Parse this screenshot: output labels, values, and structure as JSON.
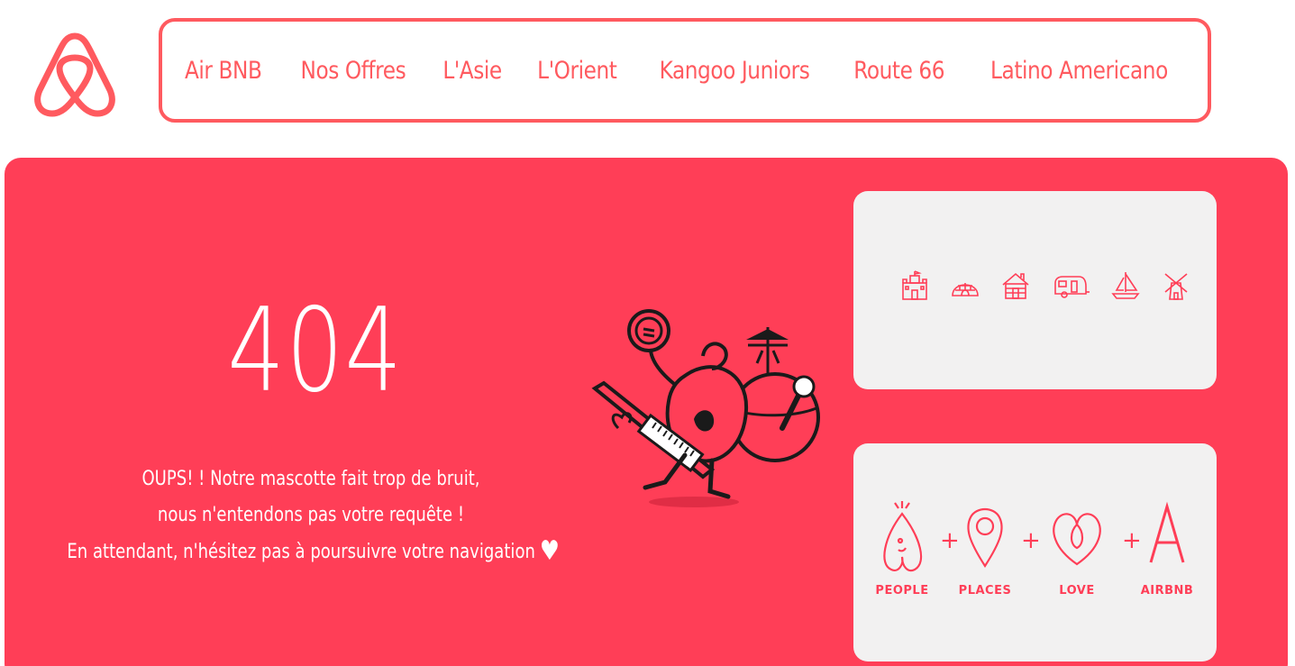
{
  "brand": {
    "logo_icon": "airbnb-belo-icon",
    "accent_color": "#ff5a5f",
    "panel_color": "#ff3e57"
  },
  "nav": {
    "items": [
      {
        "label": "Air BNB"
      },
      {
        "label": "Nos Offres"
      },
      {
        "label": "L'Asie"
      },
      {
        "label": "L'Orient"
      },
      {
        "label": "Kangoo Juniors"
      },
      {
        "label": "Route 66"
      },
      {
        "label": "Latino Americano"
      }
    ]
  },
  "error": {
    "code": "404",
    "message_line1": "OUPS! ! Notre mascotte fait trop de bruit,",
    "message_line2": "nous n'entendons pas votre requête !",
    "message_line3": "En attendant, n'hésitez pas à poursuivre votre navigation",
    "heart_icon": "♥"
  },
  "illustration": {
    "icon": "mascot-band-icon"
  },
  "places_card": {
    "icons": [
      "castle-icon",
      "igloo-icon",
      "cabin-icon",
      "camper-icon",
      "sailboat-icon",
      "windmill-icon"
    ]
  },
  "equation_card": {
    "terms": [
      {
        "label": "PEOPLE",
        "icon": "people-icon"
      },
      {
        "label": "PLACES",
        "icon": "pin-icon"
      },
      {
        "label": "LOVE",
        "icon": "heart-icon"
      },
      {
        "label": "AIRBNB",
        "icon": "letter-a-icon"
      }
    ],
    "operator": "+"
  }
}
